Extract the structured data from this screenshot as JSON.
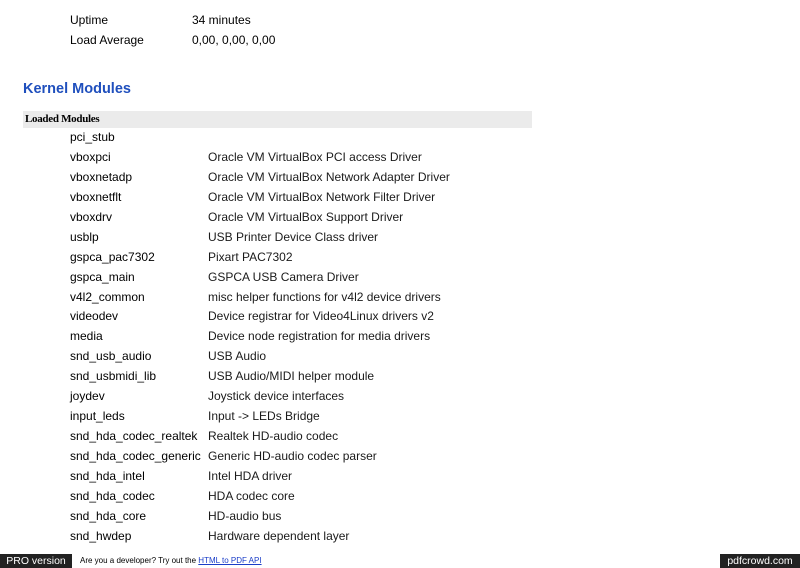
{
  "system": {
    "rows": [
      {
        "key": "Uptime",
        "value": "34 minutes"
      },
      {
        "key": "Load Average",
        "value": "0,00, 0,00, 0,00"
      }
    ]
  },
  "kernel": {
    "title": "Kernel Modules",
    "subheader": "Loaded Modules",
    "modules": [
      {
        "name": "pci_stub",
        "desc": ""
      },
      {
        "name": "vboxpci",
        "desc": "Oracle VM VirtualBox PCI access Driver"
      },
      {
        "name": "vboxnetadp",
        "desc": "Oracle VM VirtualBox Network Adapter Driver"
      },
      {
        "name": "vboxnetflt",
        "desc": "Oracle VM VirtualBox Network Filter Driver"
      },
      {
        "name": "vboxdrv",
        "desc": "Oracle VM VirtualBox Support Driver"
      },
      {
        "name": "usblp",
        "desc": "USB Printer Device Class driver"
      },
      {
        "name": "gspca_pac7302",
        "desc": "Pixart PAC7302"
      },
      {
        "name": "gspca_main",
        "desc": "GSPCA USB Camera Driver"
      },
      {
        "name": "v4l2_common",
        "desc": "misc helper functions for v4l2 device drivers"
      },
      {
        "name": "videodev",
        "desc": "Device registrar for Video4Linux drivers v2"
      },
      {
        "name": "media",
        "desc": "Device node registration for media drivers"
      },
      {
        "name": "snd_usb_audio",
        "desc": "USB Audio"
      },
      {
        "name": "snd_usbmidi_lib",
        "desc": "USB Audio/MIDI helper module"
      },
      {
        "name": "joydev",
        "desc": "Joystick device interfaces"
      },
      {
        "name": "input_leds",
        "desc": "Input -> LEDs Bridge"
      },
      {
        "name": "snd_hda_codec_realtek",
        "desc": "Realtek HD-audio codec"
      },
      {
        "name": "snd_hda_codec_generic",
        "desc": "Generic HD-audio codec parser"
      },
      {
        "name": "snd_hda_intel",
        "desc": "Intel HDA driver"
      },
      {
        "name": "snd_hda_codec",
        "desc": "HDA codec core"
      },
      {
        "name": "snd_hda_core",
        "desc": "HD-audio bus"
      },
      {
        "name": "snd_hwdep",
        "desc": "Hardware dependent layer"
      }
    ]
  },
  "footer": {
    "pro_label": "PRO version",
    "promo_text": "Are you a developer? Try out the ",
    "promo_link": "HTML to PDF API",
    "brand": "pdfcrowd.com"
  }
}
